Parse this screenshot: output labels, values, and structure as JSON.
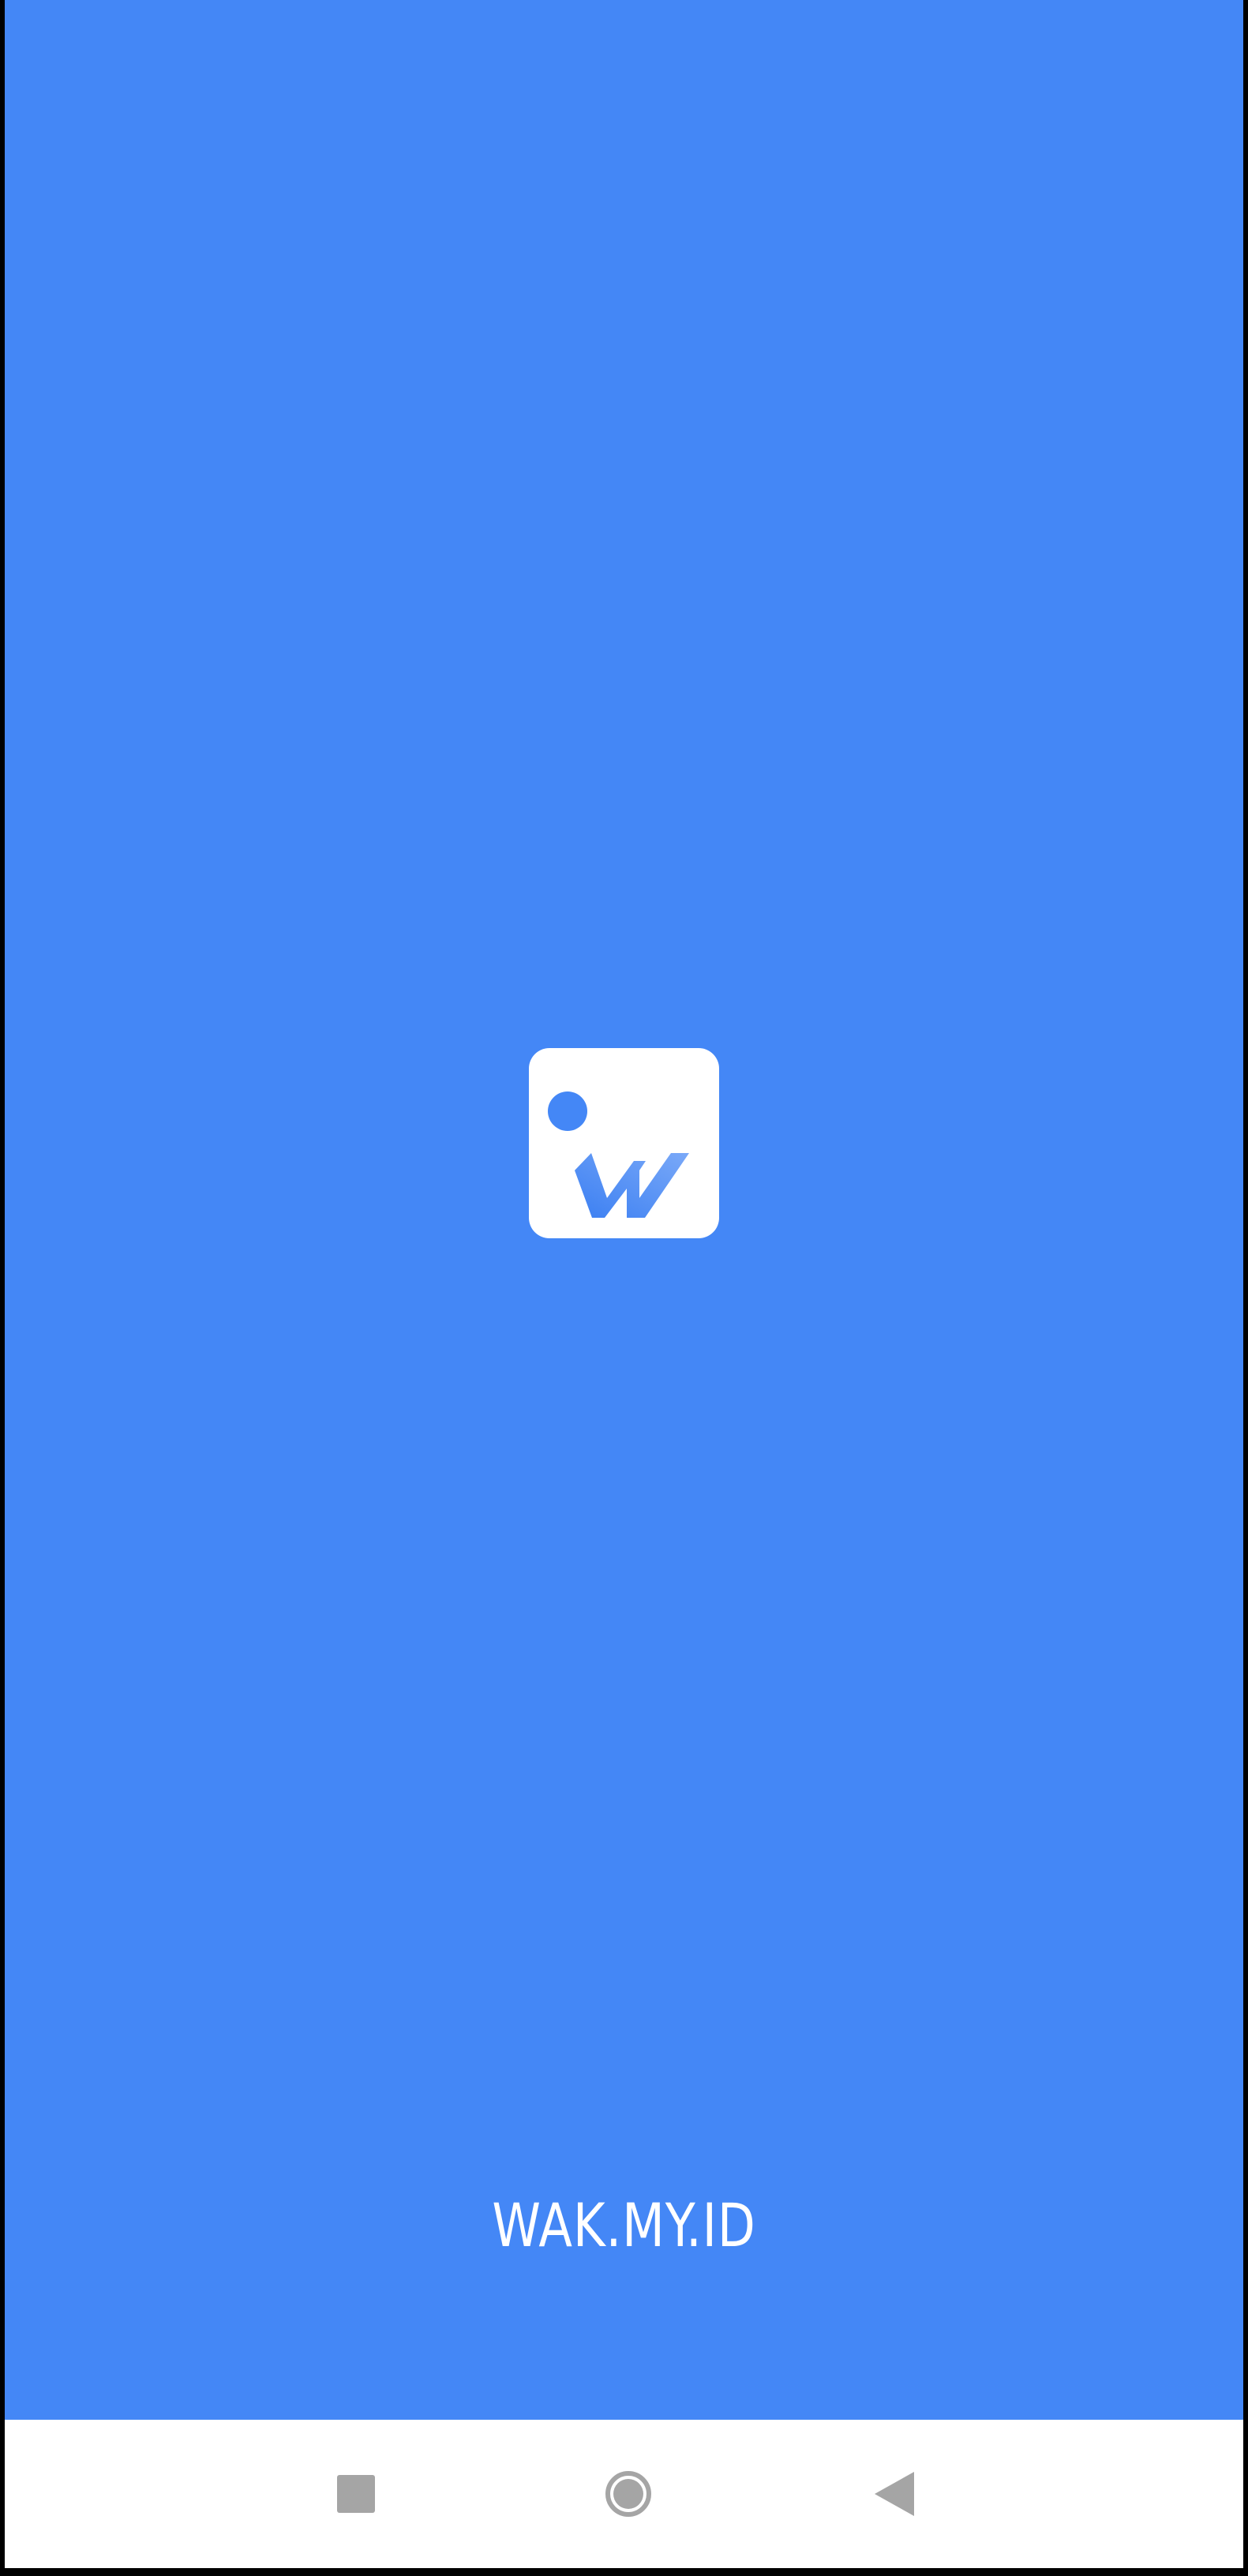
{
  "splash": {
    "background_color": "#4487f6",
    "logo": {
      "icon": "wak-logo-icon",
      "tile_color": "#ffffff",
      "mark_color": "#4487f6"
    },
    "brand_text": "WAK.MY.ID"
  },
  "navigation_bar": {
    "icon_color": "#a5a5a5",
    "buttons": [
      {
        "name": "recent-apps",
        "icon": "square-icon"
      },
      {
        "name": "home",
        "icon": "circle-icon"
      },
      {
        "name": "back",
        "icon": "triangle-back-icon"
      }
    ]
  }
}
